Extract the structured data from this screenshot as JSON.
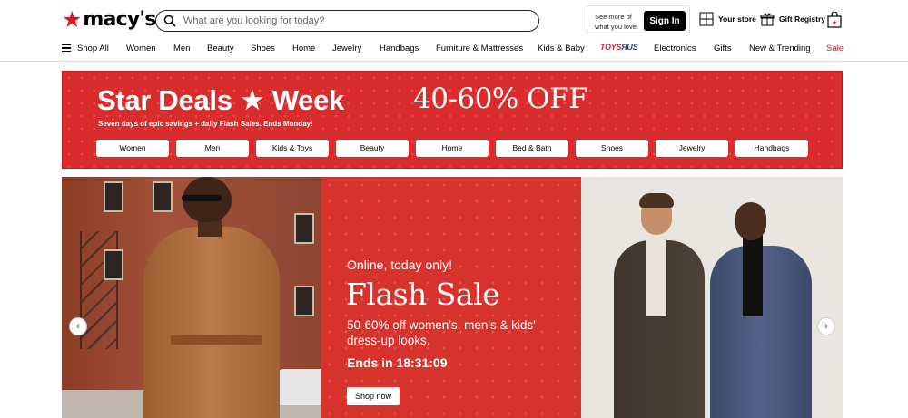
{
  "header": {
    "logo_text": "macy's",
    "logo_star": "★",
    "search_placeholder": "What are you looking for today?",
    "signin_hint": "See more of what you love",
    "signin_label": "Sign In",
    "your_store": "Your store",
    "gift_registry": "Gift Registry"
  },
  "nav": {
    "shop_all": "Shop All",
    "items": [
      "Women",
      "Men",
      "Beauty",
      "Shoes",
      "Home",
      "Jewelry",
      "Handbags",
      "Furniture & Mattresses",
      "Kids & Baby"
    ],
    "toys_a": "TOYS",
    "toys_b": "ЯUS",
    "items2": [
      "Electronics",
      "Gifts",
      "New & Trending"
    ],
    "sale": "Sale"
  },
  "deals": {
    "title": "Star Deals ★ Week",
    "subtitle": "Seven days of epic savings + daily Flash Sales. Ends Monday!",
    "offer": "40-60% OFF",
    "pills": [
      "Women",
      "Men",
      "Kids & Toys",
      "Beauty",
      "Home",
      "Bed & Bath",
      "Shoes",
      "Jewelry",
      "Handbags"
    ]
  },
  "hero": {
    "kicker": "Online, today only!",
    "title": "Flash Sale",
    "description": "50-60% off women's, men's & kids' dress-up looks.",
    "timer": "Ends in 18:31:09",
    "cta": "Shop now",
    "prev": "‹",
    "next": "›"
  },
  "colors": {
    "brand_red": "#e11a2b",
    "banner_red": "#da2c2c"
  }
}
